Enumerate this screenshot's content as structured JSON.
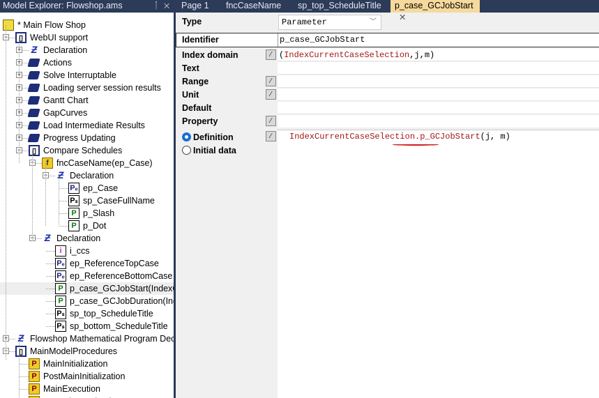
{
  "explorer": {
    "title": "Model Explorer: Flowshop.ams",
    "pin": "ᛙ",
    "close": "✕",
    "nodes": [
      {
        "level": 0,
        "label": "* Main Flow Shop",
        "icon": "root",
        "exp": ""
      },
      {
        "level": 1,
        "label": "WebUI support",
        "icon": "open",
        "exp": "-"
      },
      {
        "level": 2,
        "label": "Declaration",
        "icon": "decl",
        "exp": "+"
      },
      {
        "level": 2,
        "label": "Actions",
        "icon": "book",
        "exp": "+"
      },
      {
        "level": 2,
        "label": "Solve Interruptable",
        "icon": "book",
        "exp": "+"
      },
      {
        "level": 2,
        "label": "Loading server session results",
        "icon": "book",
        "exp": "+"
      },
      {
        "level": 2,
        "label": "Gantt Chart",
        "icon": "book",
        "exp": "+"
      },
      {
        "level": 2,
        "label": "GapCurves",
        "icon": "book",
        "exp": "+"
      },
      {
        "level": 2,
        "label": "Load Intermediate Results",
        "icon": "book",
        "exp": "+"
      },
      {
        "level": 2,
        "label": "Progress Updating",
        "icon": "book",
        "exp": "+"
      },
      {
        "level": 2,
        "label": "Compare Schedules",
        "icon": "open",
        "exp": "-"
      },
      {
        "level": 3,
        "label": "fncCaseName(ep_Case)",
        "icon": "func",
        "exp": "-"
      },
      {
        "level": 4,
        "label": "Declaration",
        "icon": "decl",
        "exp": "-"
      },
      {
        "level": 5,
        "label": "ep_Case",
        "icon": "PE",
        "exp": ""
      },
      {
        "level": 5,
        "label": "sp_CaseFullName",
        "icon": "PS",
        "exp": ""
      },
      {
        "level": 5,
        "label": "p_Slash",
        "icon": "P",
        "exp": ""
      },
      {
        "level": 5,
        "label": "p_Dot",
        "icon": "P",
        "exp": ""
      },
      {
        "level": 3,
        "label": "Declaration",
        "icon": "decl",
        "exp": "-"
      },
      {
        "level": 4,
        "label": "i_ccs",
        "icon": "I",
        "exp": ""
      },
      {
        "level": 4,
        "label": "ep_ReferenceTopCase",
        "icon": "PE",
        "exp": ""
      },
      {
        "level": 4,
        "label": "ep_ReferenceBottomCase",
        "icon": "PE",
        "exp": ""
      },
      {
        "level": 4,
        "label": "p_case_GCJobStart(IndexCurrentCaseSelection,j,m)",
        "icon": "P",
        "exp": "",
        "selected": true
      },
      {
        "level": 4,
        "label": "p_case_GCJobDuration(IndexCurrentCaseSelection,j,m)",
        "icon": "P",
        "exp": ""
      },
      {
        "level": 4,
        "label": "sp_top_ScheduleTitle",
        "icon": "PS",
        "exp": ""
      },
      {
        "level": 4,
        "label": "sp_bottom_ScheduleTitle",
        "icon": "PS",
        "exp": ""
      },
      {
        "level": 1,
        "label": "Flowshop Mathematical Program Declaration",
        "icon": "decl",
        "exp": "+"
      },
      {
        "level": 1,
        "label": "MainModelProcedures",
        "icon": "open",
        "exp": "-"
      },
      {
        "level": 2,
        "label": "MainInitialization",
        "icon": "proc",
        "exp": ""
      },
      {
        "level": 2,
        "label": "PostMainInitialization",
        "icon": "proc",
        "exp": ""
      },
      {
        "level": 2,
        "label": "MainExecution",
        "icon": "proc",
        "exp": ""
      },
      {
        "level": 2,
        "label": "PreMainTermination",
        "icon": "proc",
        "exp": ""
      }
    ]
  },
  "tabs": [
    {
      "label": "Page 1"
    },
    {
      "label": "fncCaseName"
    },
    {
      "label": "sp_top_ScheduleTitle"
    },
    {
      "label": "p_case_GCJobStart",
      "active": true,
      "close": "✕"
    }
  ],
  "attributes": {
    "type_label": "Type",
    "type_value": "Parameter",
    "chevron": "﹀",
    "identifier_label": "Identifier",
    "identifier_value": "p_case_GCJobStart",
    "index_domain_label": "Index domain",
    "index_domain_value": {
      "open": "(",
      "name": "IndexCurrentCaseSelection",
      "rest": ",j,m)"
    },
    "text_label": "Text",
    "range_label": "Range",
    "unit_label": "Unit",
    "default_label": "Default",
    "property_label": "Property",
    "definition_label": "Definition",
    "initial_data_label": "Initial data",
    "definition_value": {
      "name": "IndexCurrentCaseSelection.p_GCJobStart",
      "rest": "(j, m)"
    },
    "wizard_glyph": "⁄"
  }
}
